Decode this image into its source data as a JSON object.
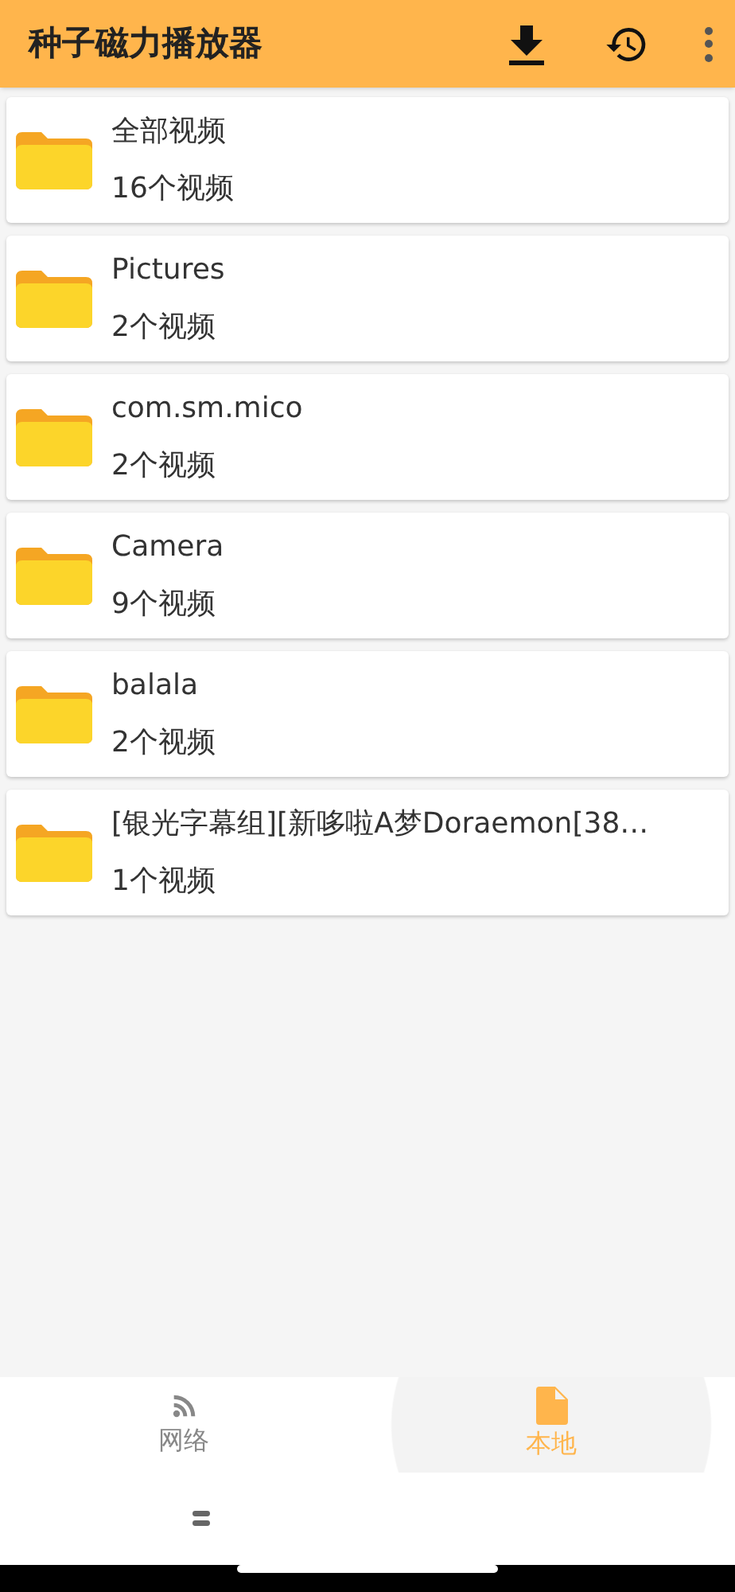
{
  "app_bar": {
    "title": "种子磁力播放器"
  },
  "folders": [
    {
      "name": "全部视频",
      "count": "16个视频"
    },
    {
      "name": "Pictures",
      "count": "2个视频"
    },
    {
      "name": "com.sm.mico",
      "count": "2个视频"
    },
    {
      "name": "Camera",
      "count": "9个视频"
    },
    {
      "name": "balala",
      "count": "2个视频"
    },
    {
      "name": "[银光字幕组][新哆啦A梦Doraemon[38…",
      "count": "1个视频"
    }
  ],
  "bottom_nav": [
    {
      "kind": "network",
      "label": "网络",
      "selected": false
    },
    {
      "kind": "local",
      "label": "本地",
      "selected": true
    }
  ]
}
